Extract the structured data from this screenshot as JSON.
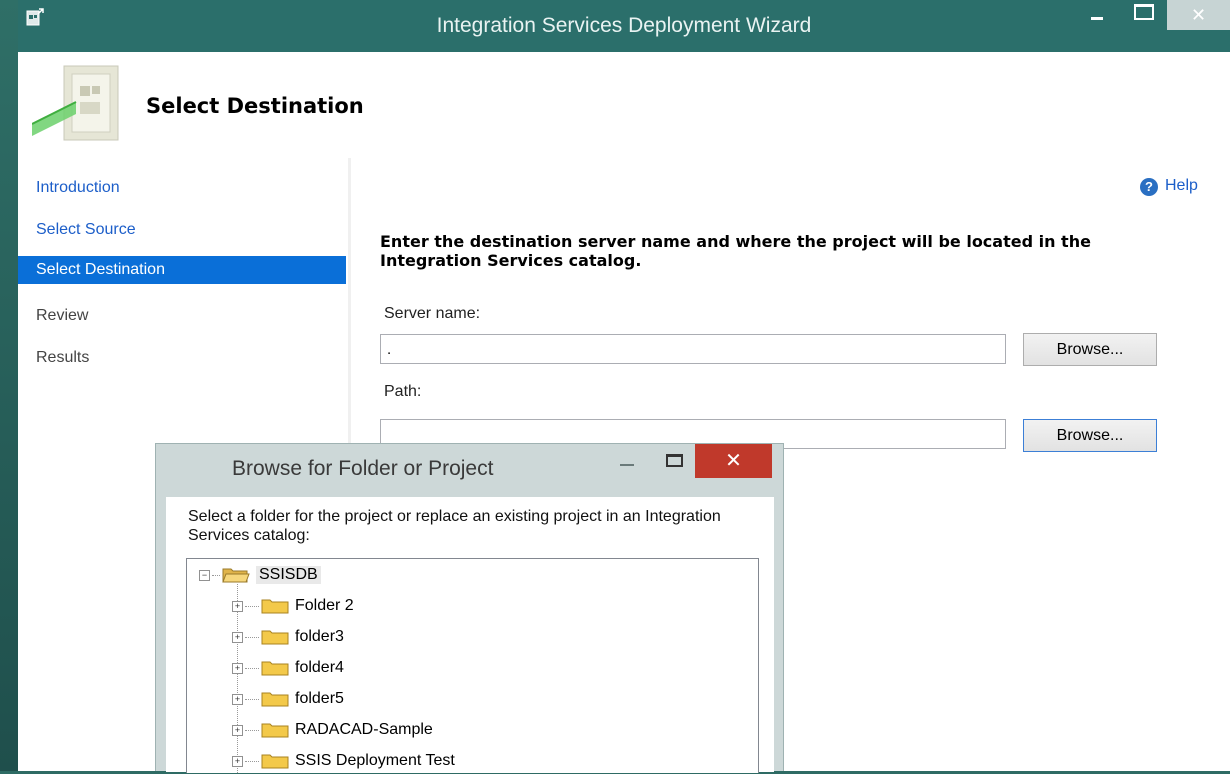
{
  "window": {
    "title": "Integration Services Deployment Wizard",
    "close_symbol": "✕"
  },
  "header": {
    "title": "Select Destination"
  },
  "nav": {
    "items": [
      {
        "label": "Introduction",
        "state": "link"
      },
      {
        "label": "Select Source",
        "state": "link"
      },
      {
        "label": "Select Destination",
        "state": "active"
      },
      {
        "label": "Review",
        "state": "plain"
      },
      {
        "label": "Results",
        "state": "plain"
      }
    ]
  },
  "content": {
    "help_label": "Help",
    "help_icon_glyph": "?",
    "instruction": "Enter the destination server name and where the project will be located in the Integration Services catalog.",
    "server_label": "Server name:",
    "server_value": ".",
    "path_label": "Path:",
    "path_value": "",
    "browse_label": "Browse..."
  },
  "dialog": {
    "title": "Browse for Folder or Project",
    "close_symbol": "✕",
    "instruction": "Select a folder for the project or replace an existing project in an Integration Services catalog:",
    "tree": {
      "root": "SSISDB",
      "root_expander": "−",
      "child_expander": "+",
      "children": [
        "Folder 2",
        "folder3",
        "folder4",
        "folder5",
        "RADACAD-Sample",
        "SSIS Deployment Test"
      ]
    }
  },
  "colors": {
    "title_bar": "#2b6f6b",
    "nav_active": "#0a6fd8",
    "link": "#1c5ec9",
    "dialog_close": "#c0392b"
  }
}
